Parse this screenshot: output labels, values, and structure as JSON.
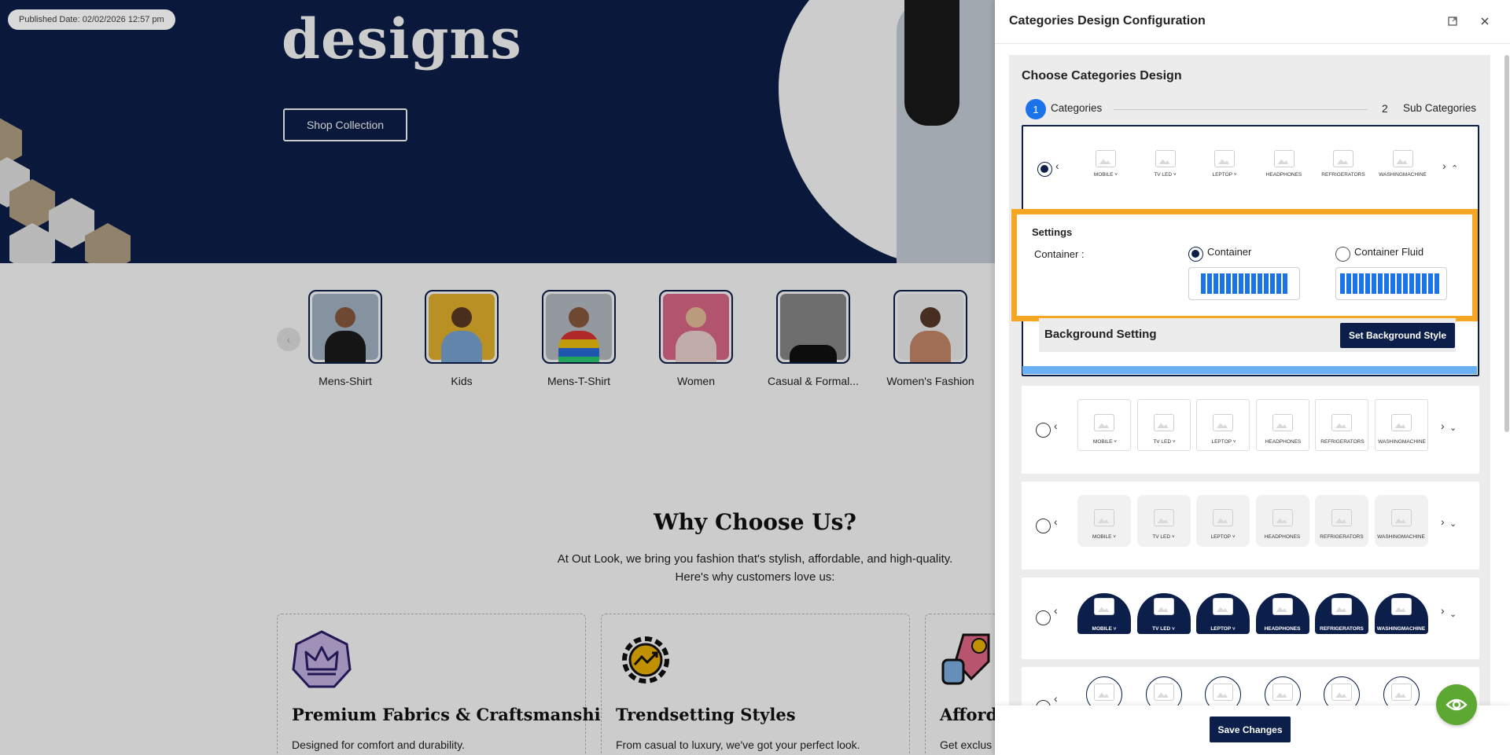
{
  "store": {
    "hero_title": "designs",
    "shop_button": "Shop Collection",
    "published_date": "Published Date: 02/02/2026 12:57 pm",
    "categories": [
      {
        "label": "Mens-Shirt"
      },
      {
        "label": "Kids"
      },
      {
        "label": "Mens-T-Shirt"
      },
      {
        "label": "Women"
      },
      {
        "label": "Casual & Formal..."
      },
      {
        "label": "Women's Fashion"
      }
    ],
    "why_title": "Why Choose Us?",
    "why_sub_1": "At Out Look, we bring you fashion that's stylish, affordable, and high-quality.",
    "why_sub_2": "Here's why customers love us:",
    "features": [
      {
        "title": "Premium Fabrics & Craftsmanship",
        "desc": "Designed for comfort and durability."
      },
      {
        "title": "Trendsetting Styles",
        "desc": "From casual to luxury, we've got your perfect look."
      },
      {
        "title": "Afforda",
        "desc": "Get exclus"
      }
    ]
  },
  "panel": {
    "title": "Categories Design Configuration",
    "choose_title": "Choose Categories Design",
    "steps": [
      {
        "num": "1",
        "label": "Categories"
      },
      {
        "num": "2",
        "label": "Sub Categories"
      }
    ],
    "tile_labels": [
      "MOBILE",
      "TV LED",
      "LEPTOP",
      "HEADPHONES",
      "REFRIGERATORS",
      "WASHINGMACHINE"
    ],
    "settings": {
      "title": "Settings",
      "container_label": "Container :",
      "option_container": "Container",
      "option_fluid": "Container Fluid"
    },
    "background": {
      "title": "Background Setting",
      "button": "Set Background Style"
    },
    "save_button": "Save Changes"
  },
  "colors": {
    "navy": "#0c1f4a",
    "accent_blue": "#1a73e8",
    "highlight": "#f5a623",
    "preview_green": "#5da832"
  }
}
